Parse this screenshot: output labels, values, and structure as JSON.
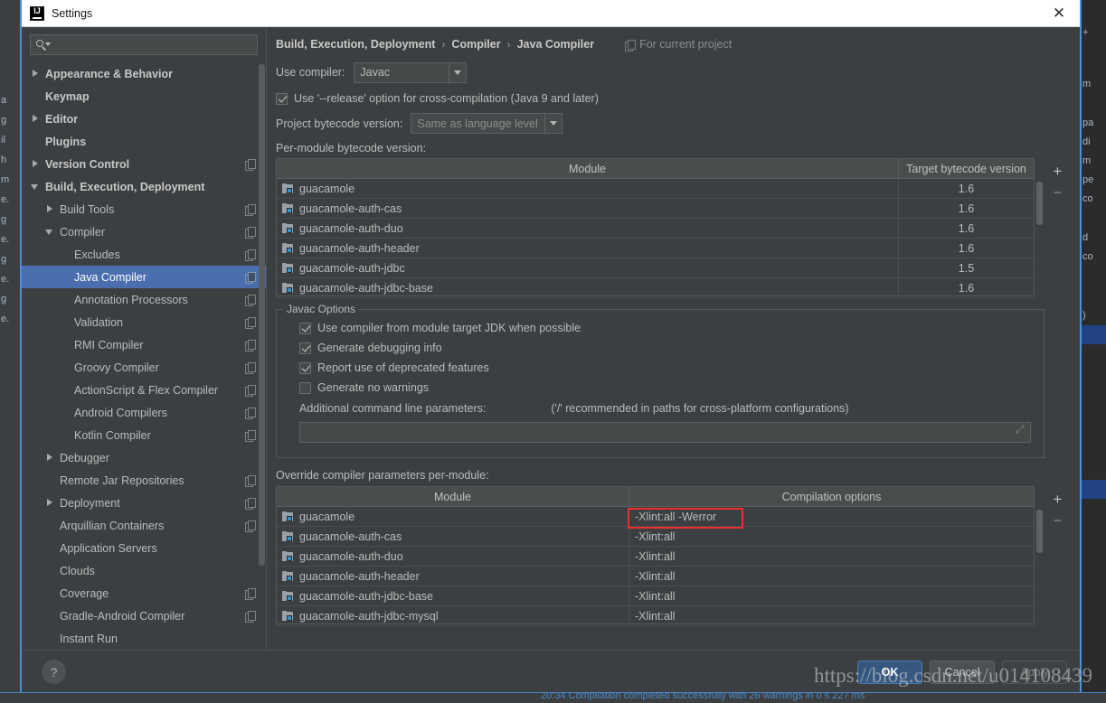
{
  "window": {
    "title": "Settings",
    "logo_icon": "intellij-idea-logo-icon",
    "close_icon": "close-icon"
  },
  "search": {
    "icon": "search-icon",
    "value": "",
    "placeholder": ""
  },
  "sidebar": {
    "items": [
      {
        "label": "Appearance & Behavior",
        "indent": 0,
        "twisty": "collapsed",
        "bold": true,
        "copy": false,
        "selected": false
      },
      {
        "label": "Keymap",
        "indent": 0,
        "twisty": "none",
        "bold": true,
        "copy": false,
        "selected": false
      },
      {
        "label": "Editor",
        "indent": 0,
        "twisty": "collapsed",
        "bold": true,
        "copy": false,
        "selected": false
      },
      {
        "label": "Plugins",
        "indent": 0,
        "twisty": "none",
        "bold": true,
        "copy": false,
        "selected": false
      },
      {
        "label": "Version Control",
        "indent": 0,
        "twisty": "collapsed",
        "bold": true,
        "copy": true,
        "selected": false
      },
      {
        "label": "Build, Execution, Deployment",
        "indent": 0,
        "twisty": "expanded",
        "bold": true,
        "copy": false,
        "selected": false
      },
      {
        "label": "Build Tools",
        "indent": 1,
        "twisty": "collapsed",
        "bold": false,
        "copy": true,
        "selected": false
      },
      {
        "label": "Compiler",
        "indent": 1,
        "twisty": "expanded",
        "bold": false,
        "copy": true,
        "selected": false
      },
      {
        "label": "Excludes",
        "indent": 2,
        "twisty": "none",
        "bold": false,
        "copy": true,
        "selected": false
      },
      {
        "label": "Java Compiler",
        "indent": 2,
        "twisty": "none",
        "bold": false,
        "copy": true,
        "selected": true
      },
      {
        "label": "Annotation Processors",
        "indent": 2,
        "twisty": "none",
        "bold": false,
        "copy": true,
        "selected": false
      },
      {
        "label": "Validation",
        "indent": 2,
        "twisty": "none",
        "bold": false,
        "copy": true,
        "selected": false
      },
      {
        "label": "RMI Compiler",
        "indent": 2,
        "twisty": "none",
        "bold": false,
        "copy": true,
        "selected": false
      },
      {
        "label": "Groovy Compiler",
        "indent": 2,
        "twisty": "none",
        "bold": false,
        "copy": true,
        "selected": false
      },
      {
        "label": "ActionScript & Flex Compiler",
        "indent": 2,
        "twisty": "none",
        "bold": false,
        "copy": true,
        "selected": false
      },
      {
        "label": "Android Compilers",
        "indent": 2,
        "twisty": "none",
        "bold": false,
        "copy": true,
        "selected": false
      },
      {
        "label": "Kotlin Compiler",
        "indent": 2,
        "twisty": "none",
        "bold": false,
        "copy": true,
        "selected": false
      },
      {
        "label": "Debugger",
        "indent": 1,
        "twisty": "collapsed",
        "bold": false,
        "copy": false,
        "selected": false
      },
      {
        "label": "Remote Jar Repositories",
        "indent": 1,
        "twisty": "none",
        "bold": false,
        "copy": true,
        "selected": false
      },
      {
        "label": "Deployment",
        "indent": 1,
        "twisty": "collapsed",
        "bold": false,
        "copy": true,
        "selected": false
      },
      {
        "label": "Arquillian Containers",
        "indent": 1,
        "twisty": "none",
        "bold": false,
        "copy": true,
        "selected": false
      },
      {
        "label": "Application Servers",
        "indent": 1,
        "twisty": "none",
        "bold": false,
        "copy": false,
        "selected": false
      },
      {
        "label": "Clouds",
        "indent": 1,
        "twisty": "none",
        "bold": false,
        "copy": false,
        "selected": false
      },
      {
        "label": "Coverage",
        "indent": 1,
        "twisty": "none",
        "bold": false,
        "copy": true,
        "selected": false
      },
      {
        "label": "Gradle-Android Compiler",
        "indent": 1,
        "twisty": "none",
        "bold": false,
        "copy": true,
        "selected": false
      },
      {
        "label": "Instant Run",
        "indent": 1,
        "twisty": "none",
        "bold": false,
        "copy": false,
        "selected": false
      }
    ]
  },
  "content": {
    "breadcrumb": [
      "Build, Execution, Deployment",
      "Compiler",
      "Java Compiler"
    ],
    "breadcrumb_separator": "›",
    "scope_label": "For current project",
    "scope_icon": "copy-icon",
    "use_compiler_label": "Use compiler:",
    "use_compiler_value": "Javac",
    "release_option": {
      "label": "Use '--release' option for cross-compilation (Java 9 and later)",
      "checked": true
    },
    "project_bytecode_label": "Project bytecode version:",
    "project_bytecode_value": "Same as language level",
    "per_module_label": "Per-module bytecode version:",
    "bytecode_table": {
      "columns": [
        "Module",
        "Target bytecode version"
      ],
      "rows": [
        {
          "module": "guacamole",
          "target": "1.6"
        },
        {
          "module": "guacamole-auth-cas",
          "target": "1.6"
        },
        {
          "module": "guacamole-auth-duo",
          "target": "1.6"
        },
        {
          "module": "guacamole-auth-header",
          "target": "1.6"
        },
        {
          "module": "guacamole-auth-jdbc",
          "target": "1.5"
        },
        {
          "module": "guacamole-auth-jdbc-base",
          "target": "1.6"
        }
      ],
      "add_label": "+",
      "remove_label": "−"
    },
    "javac_group_title": "Javac Options",
    "javac_checkboxes": [
      {
        "label": "Use compiler from module target JDK when possible",
        "checked": true
      },
      {
        "label": "Generate debugging info",
        "checked": true
      },
      {
        "label": "Report use of deprecated features",
        "checked": true
      },
      {
        "label": "Generate no warnings",
        "checked": false
      }
    ],
    "additional_params_label": "Additional command line parameters:",
    "additional_params_hint": "('/' recommended in paths for cross-platform configurations)",
    "additional_params_value": "",
    "override_label": "Override compiler parameters per-module:",
    "override_table": {
      "columns": [
        "Module",
        "Compilation options"
      ],
      "rows": [
        {
          "module": "guacamole",
          "options": "-Xlint:all -Werror",
          "highlighted": true
        },
        {
          "module": "guacamole-auth-cas",
          "options": "-Xlint:all",
          "highlighted": false
        },
        {
          "module": "guacamole-auth-duo",
          "options": "-Xlint:all",
          "highlighted": false
        },
        {
          "module": "guacamole-auth-header",
          "options": "-Xlint:all",
          "highlighted": false
        },
        {
          "module": "guacamole-auth-jdbc-base",
          "options": "-Xlint:all",
          "highlighted": false
        },
        {
          "module": "guacamole-auth-jdbc-mysql",
          "options": "-Xlint:all",
          "highlighted": false
        }
      ],
      "add_label": "+",
      "remove_label": "−"
    },
    "highlight_color": "#ee2e2e"
  },
  "footer": {
    "help_label": "?",
    "ok_label": "OK",
    "cancel_label": "Cancel",
    "apply_label": "Apply"
  },
  "overlay": {
    "watermark": "https://blog.csdn.net/u014108439",
    "status_text": "20:34 Compilation completed successfully with 26 warnings in 0 s 227 ms"
  },
  "background": {
    "left_fragments": [
      "a",
      "g",
      "il",
      "h",
      "m",
      "e.",
      "g",
      "e.",
      "g",
      "e.",
      "g",
      "e."
    ],
    "right_fragments": [
      "+",
      "m",
      "pa",
      "di",
      "m",
      "pe",
      "co",
      "d",
      "co",
      ")"
    ]
  },
  "colors": {
    "accent": "#4b6eaf",
    "dialog_bg": "#3c3f41",
    "border": "#4a90d9",
    "primary_button": "#365880",
    "status_text": "#4a88c7"
  }
}
